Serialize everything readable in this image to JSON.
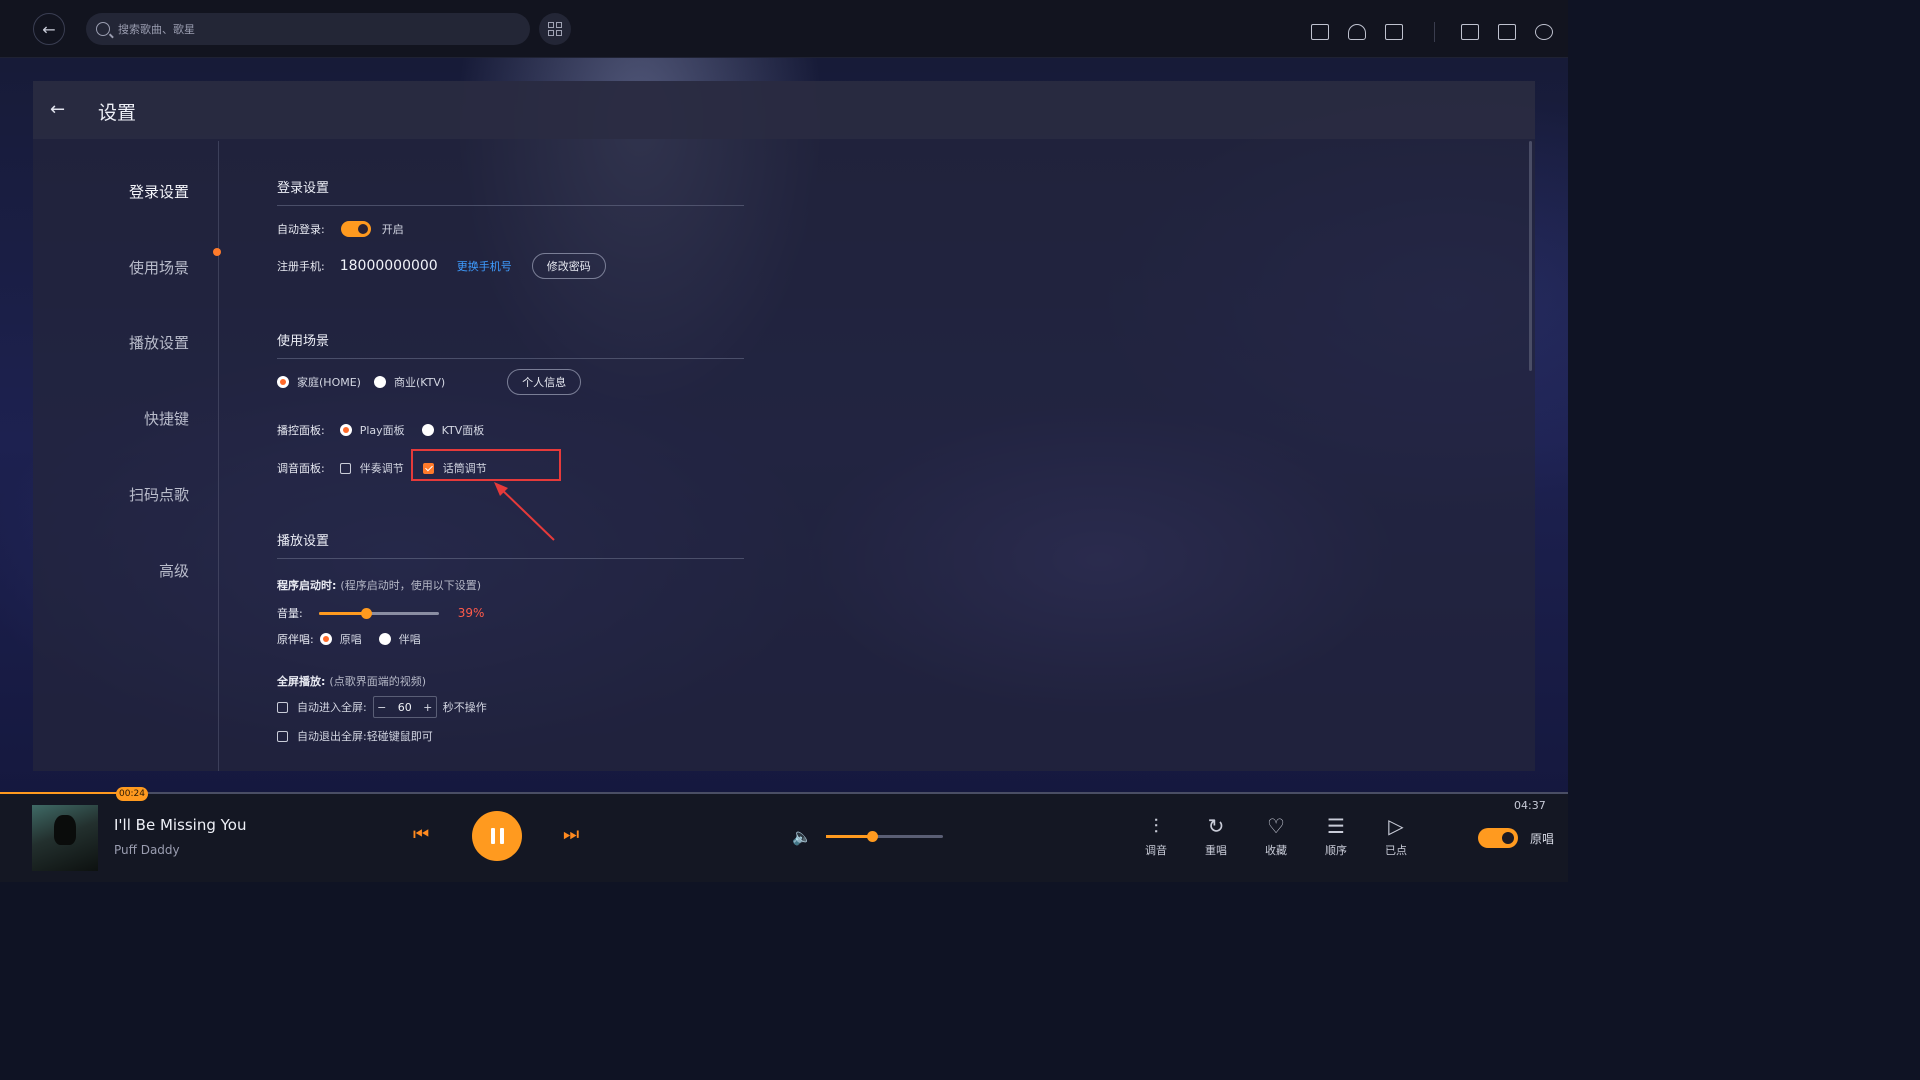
{
  "topbar": {
    "search_placeholder": "搜索歌曲、歌星",
    "icons": [
      "back-icon",
      "qr-icon",
      "mail-icon",
      "headset-icon",
      "screen-icon",
      "window-icon",
      "download-icon",
      "power-icon"
    ]
  },
  "settings": {
    "title": "设置",
    "nav": [
      "登录设置",
      "使用场景",
      "播放设置",
      "快捷键",
      "扫码点歌",
      "高级"
    ],
    "login": {
      "section_title": "登录设置",
      "auto_login_label": "自动登录:",
      "auto_login_state": "开启",
      "phone_label": "注册手机:",
      "phone_value": "18000000000",
      "change_phone": "更换手机号",
      "change_password": "修改密码"
    },
    "scene": {
      "section_title": "使用场景",
      "home": "家庭(HOME)",
      "ktv": "商业(KTV)",
      "personal_info": "个人信息",
      "panel_label": "播控面板:",
      "play_panel": "Play面板",
      "ktv_panel": "KTV面板",
      "tuning_label": "调音面板:",
      "accompany_adjust": "伴奏调节",
      "mic_adjust": "话筒调节"
    },
    "play": {
      "section_title": "播放设置",
      "startup_label": "程序启动时:",
      "startup_note": "(程序启动时，使用以下设置)",
      "volume_label": "音量:",
      "volume_value": "39%",
      "volume_level": 0.39,
      "vocal_label": "原伴唱:",
      "original": "原唱",
      "accompany": "伴唱",
      "fullscreen_label": "全屏播放:",
      "fullscreen_note": "(点歌界面端的视频)",
      "auto_enter_label": "自动进入全屏:",
      "auto_enter_seconds": "60",
      "auto_enter_suffix": "秒不操作",
      "auto_exit_label": "自动退出全屏:",
      "auto_exit_note": "轻碰键鼠即可"
    }
  },
  "player": {
    "current_time": "00:24",
    "total_time": "04:37",
    "progress": 0.087,
    "song_title": "I'll Be Missing You",
    "artist": "Puff Daddy",
    "volume_level": 0.39,
    "tools": [
      "调音",
      "重唱",
      "收藏",
      "顺序",
      "已点"
    ],
    "original_label": "原唱"
  },
  "colors": {
    "accent": "#ff9a1f",
    "link": "#3e9cff",
    "highlight": "#e63a3a"
  }
}
